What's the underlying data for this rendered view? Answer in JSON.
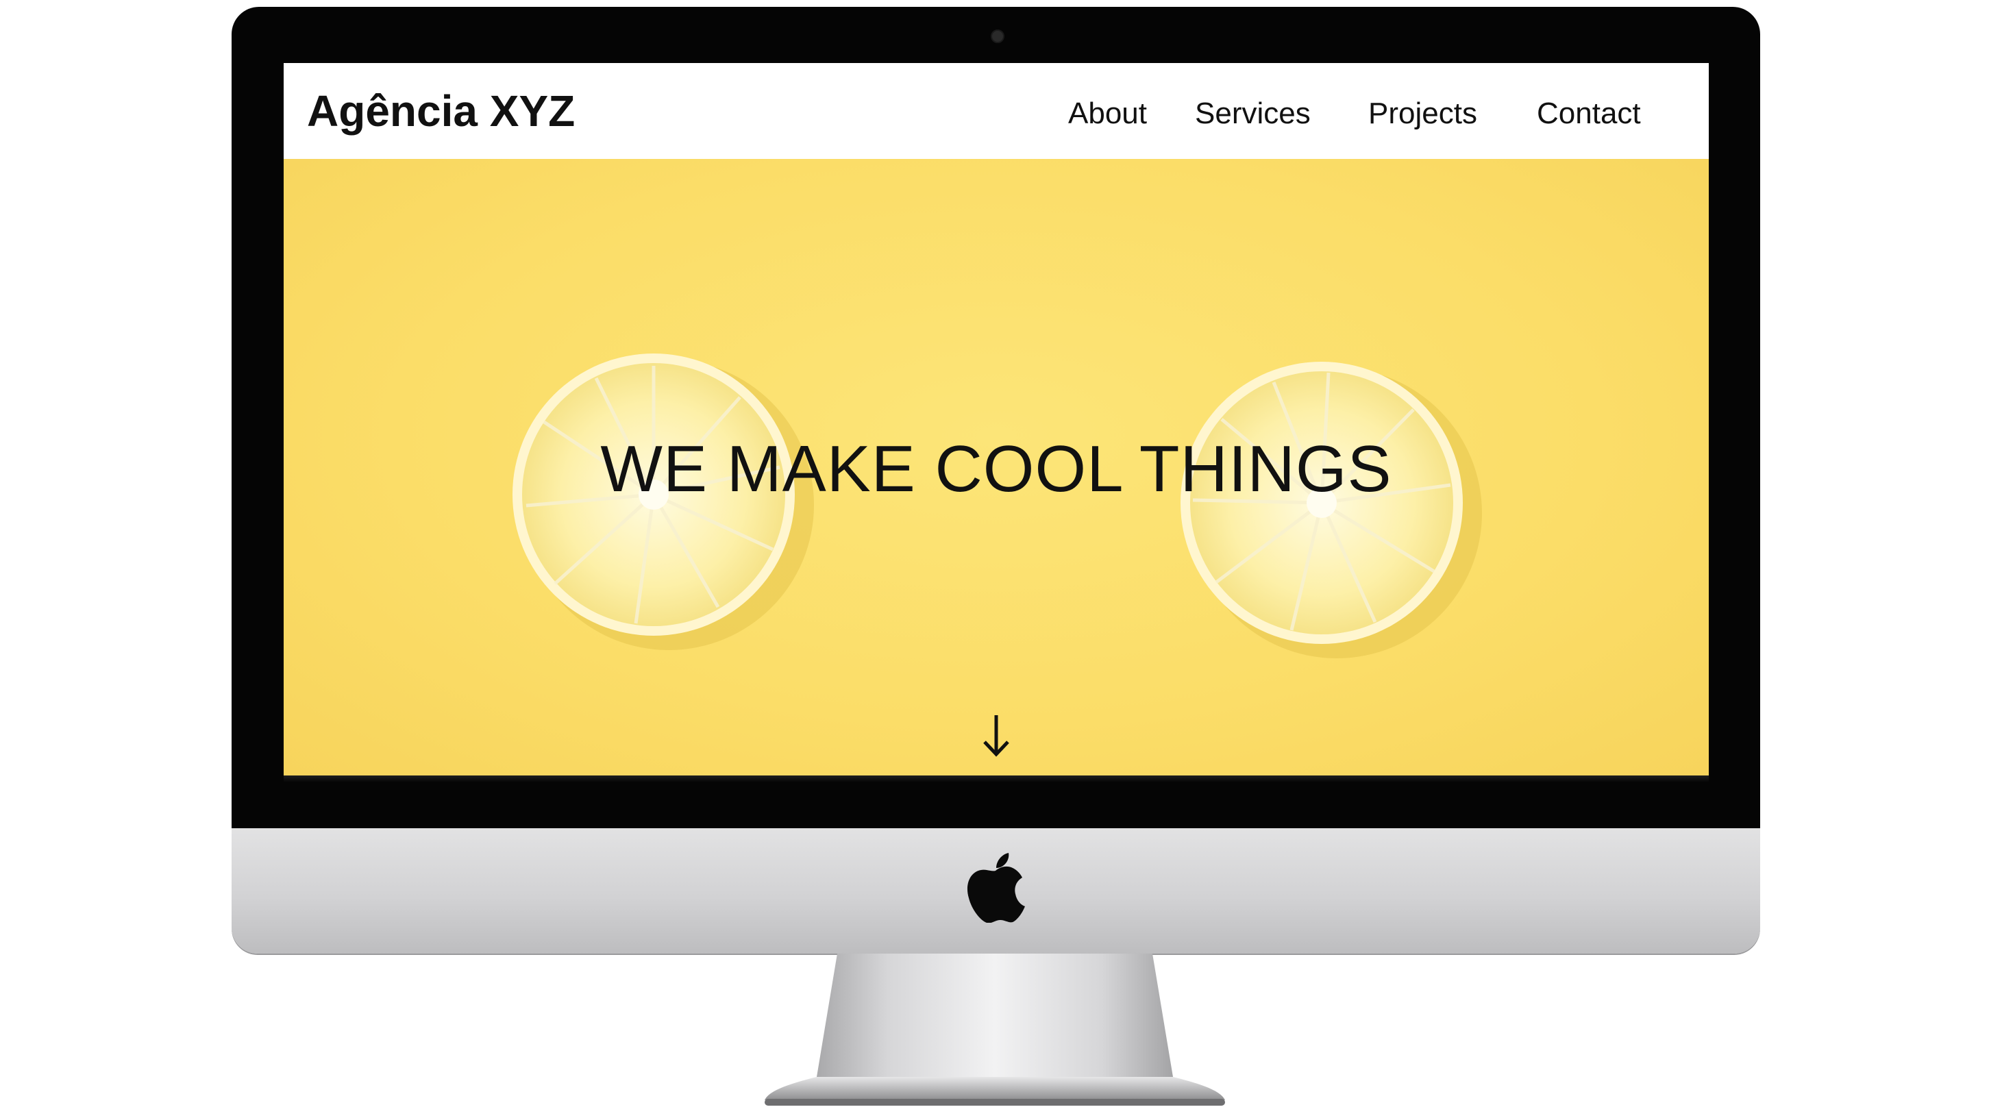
{
  "site": {
    "brand": "Agência XYZ",
    "nav": [
      {
        "label": "About"
      },
      {
        "label": "Services"
      },
      {
        "label": "Projects"
      },
      {
        "label": "Contact"
      }
    ],
    "hero": {
      "title": "WE MAKE COOL THINGS",
      "scroll_icon": "arrow-down-icon"
    }
  },
  "device": {
    "logo_icon": "apple-logo-icon"
  },
  "colors": {
    "hero_background": "#fbdf6c",
    "nav_background": "#ffffff",
    "text": "#111111",
    "bezel": "#050505"
  }
}
